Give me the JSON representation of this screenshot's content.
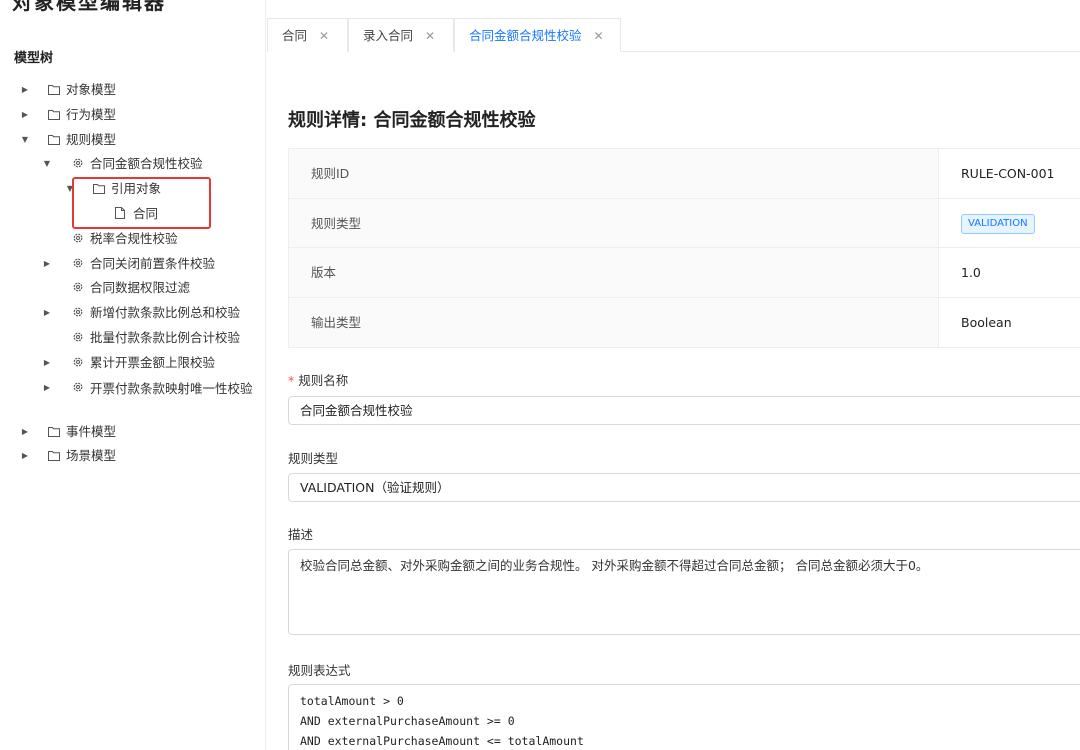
{
  "app": {
    "title": "对象模型编辑器"
  },
  "sidebar": {
    "tree_title": "模型树",
    "items": [
      {
        "label": "对象模型",
        "level": 0,
        "caret": "right",
        "icon": "folder"
      },
      {
        "label": "行为模型",
        "level": 0,
        "caret": "right",
        "icon": "folder"
      },
      {
        "label": "规则模型",
        "level": 0,
        "caret": "down",
        "icon": "folder"
      },
      {
        "label": "合同金额合规性校验",
        "level": 1,
        "caret": "down",
        "icon": "gear"
      },
      {
        "label": "引用对象",
        "level": 2,
        "caret": "down",
        "icon": "folder"
      },
      {
        "label": "合同",
        "level": 3,
        "caret": "none",
        "icon": "file"
      },
      {
        "label": "税率合规性校验",
        "level": 1,
        "caret": "none",
        "icon": "gear"
      },
      {
        "label": "合同关闭前置条件校验",
        "level": 1,
        "caret": "right",
        "icon": "gear"
      },
      {
        "label": "合同数据权限过滤",
        "level": 1,
        "caret": "none",
        "icon": "gear"
      },
      {
        "label": "新增付款条款比例总和校验",
        "level": 1,
        "caret": "right",
        "icon": "gear"
      },
      {
        "label": "批量付款条款比例合计校验",
        "level": 1,
        "caret": "none",
        "icon": "gear"
      },
      {
        "label": "累计开票金额上限校验",
        "level": 1,
        "caret": "right",
        "icon": "gear"
      },
      {
        "label": "开票付款条款映射唯一性校验",
        "level": 1,
        "caret": "right",
        "icon": "gear",
        "wrap": true
      },
      {
        "label": "事件模型",
        "level": 0,
        "caret": "right",
        "icon": "folder"
      },
      {
        "label": "场景模型",
        "level": 0,
        "caret": "right",
        "icon": "folder"
      }
    ]
  },
  "tabs": [
    {
      "label": "合同",
      "active": false
    },
    {
      "label": "录入合同",
      "active": false
    },
    {
      "label": "合同金额合规性校验",
      "active": true
    }
  ],
  "detail": {
    "title": "规则详情: 合同金额合规性校验",
    "rows": [
      {
        "label": "规则ID",
        "value": "RULE-CON-001"
      },
      {
        "label": "规则类型",
        "value": "VALIDATION",
        "tag": true
      },
      {
        "label": "版本",
        "value": "1.0"
      },
      {
        "label": "输出类型",
        "value": "Boolean"
      }
    ]
  },
  "form": {
    "name_label": "规则名称",
    "name_value": "合同金额合规性校验",
    "type_label": "规则类型",
    "type_value": "VALIDATION（验证规则）",
    "desc_label": "描述",
    "desc_value": "校验合同总金额、对外采购金额之间的业务合规性。 对外采购金额不得超过合同总金额；  合同总金额必须大于0。",
    "expr_label": "规则表达式",
    "expr_lines": [
      "totalAmount > 0",
      "AND externalPurchaseAmount >= 0",
      "AND externalPurchaseAmount <= totalAmount"
    ]
  },
  "colors": {
    "accent": "#1677ff",
    "highlight": "#e53935",
    "required": "#ff4d4f"
  }
}
